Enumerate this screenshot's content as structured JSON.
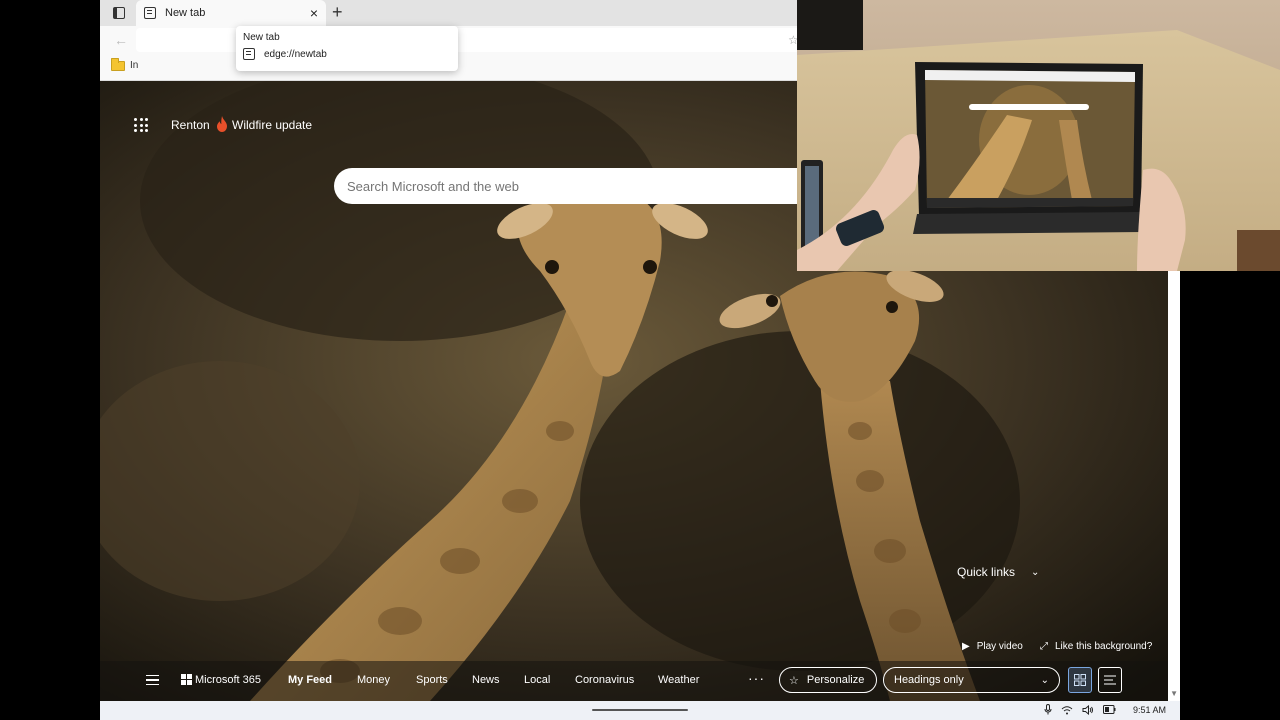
{
  "tab": {
    "title": "New tab"
  },
  "tooltip": {
    "title": "New tab",
    "url": "edge://newtab"
  },
  "favorites_bar": {
    "folder_label": "In"
  },
  "ntp": {
    "location": "Renton",
    "alert": "Wildfire update",
    "search_placeholder": "Search Microsoft and the web",
    "quick_links": "Quick links",
    "play_video": "Play video",
    "like_background": "Like this background?"
  },
  "feed": {
    "items": [
      "Microsoft 365",
      "My Feed",
      "Money",
      "Sports",
      "News",
      "Local",
      "Coronavirus",
      "Weather"
    ],
    "personalize": "Personalize",
    "headings": "Headings only"
  },
  "taskbar": {
    "time": "9:51 AM"
  },
  "colors": {
    "flame": "#e8502a",
    "grid_view_accent": "#7aa6e0"
  }
}
